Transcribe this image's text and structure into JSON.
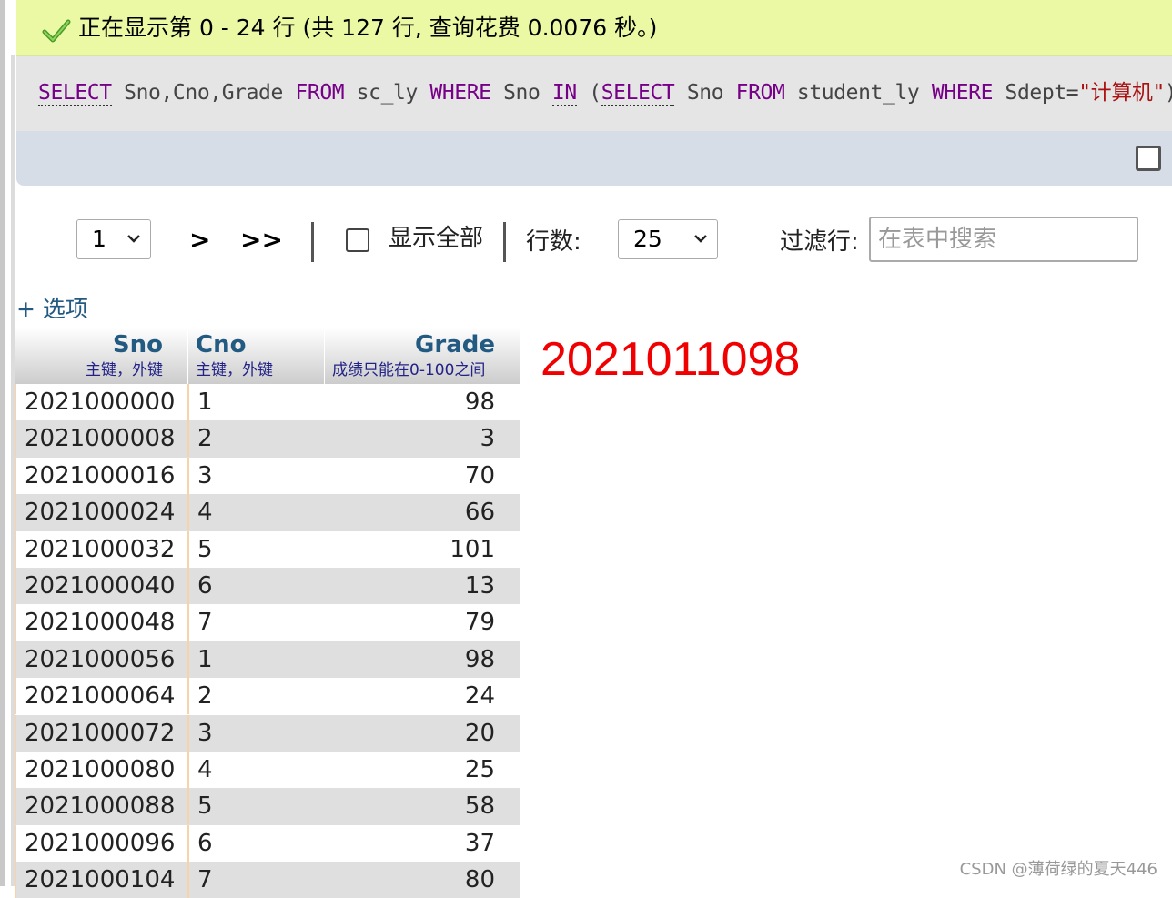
{
  "banner": {
    "icon": "check-icon",
    "color": "#ebf8a4",
    "text": "正在显示第 0 - 24 行 (共 127 行, 查询花费 0.0076 秒。)"
  },
  "sql": {
    "kw_select": "SELECT",
    "cols": "Sno,Cno,Grade",
    "kw_from": "FROM",
    "table": "sc_ly",
    "kw_where": "WHERE",
    "sno": "Sno",
    "kw_in": "IN",
    "paren_open": "(",
    "kw_select2": "SELECT",
    "sno2": "Sno",
    "kw_from2": "FROM",
    "table2": "student_ly",
    "kw_where2": "WHERE",
    "cond": "Sdept=",
    "value": "\"计算机\"",
    "paren_close": ")"
  },
  "nav": {
    "page_value": "1",
    "next": ">",
    "last": ">>",
    "show_all_label": "显示全部",
    "rows_label": "行数:",
    "rows_value": "25",
    "filter_label": "过滤行:",
    "filter_placeholder": "在表中搜索"
  },
  "options_label": "+ 选项",
  "table": {
    "columns": [
      {
        "name": "Sno",
        "comment": "主键，外键"
      },
      {
        "name": "Cno",
        "comment": "主键，外键"
      },
      {
        "name": "Grade",
        "comment": "成绩只能在0-100之间"
      }
    ],
    "rows": [
      [
        "2021000000",
        "1",
        "98"
      ],
      [
        "2021000008",
        "2",
        "3"
      ],
      [
        "2021000016",
        "3",
        "70"
      ],
      [
        "2021000024",
        "4",
        "66"
      ],
      [
        "2021000032",
        "5",
        "101"
      ],
      [
        "2021000040",
        "6",
        "13"
      ],
      [
        "2021000048",
        "7",
        "79"
      ],
      [
        "2021000056",
        "1",
        "98"
      ],
      [
        "2021000064",
        "2",
        "24"
      ],
      [
        "2021000072",
        "3",
        "20"
      ],
      [
        "2021000080",
        "4",
        "25"
      ],
      [
        "2021000088",
        "5",
        "58"
      ],
      [
        "2021000096",
        "6",
        "37"
      ],
      [
        "2021000104",
        "7",
        "80"
      ]
    ]
  },
  "annotation": "2021011098",
  "watermark": "CSDN @薄荷绿的夏天446"
}
